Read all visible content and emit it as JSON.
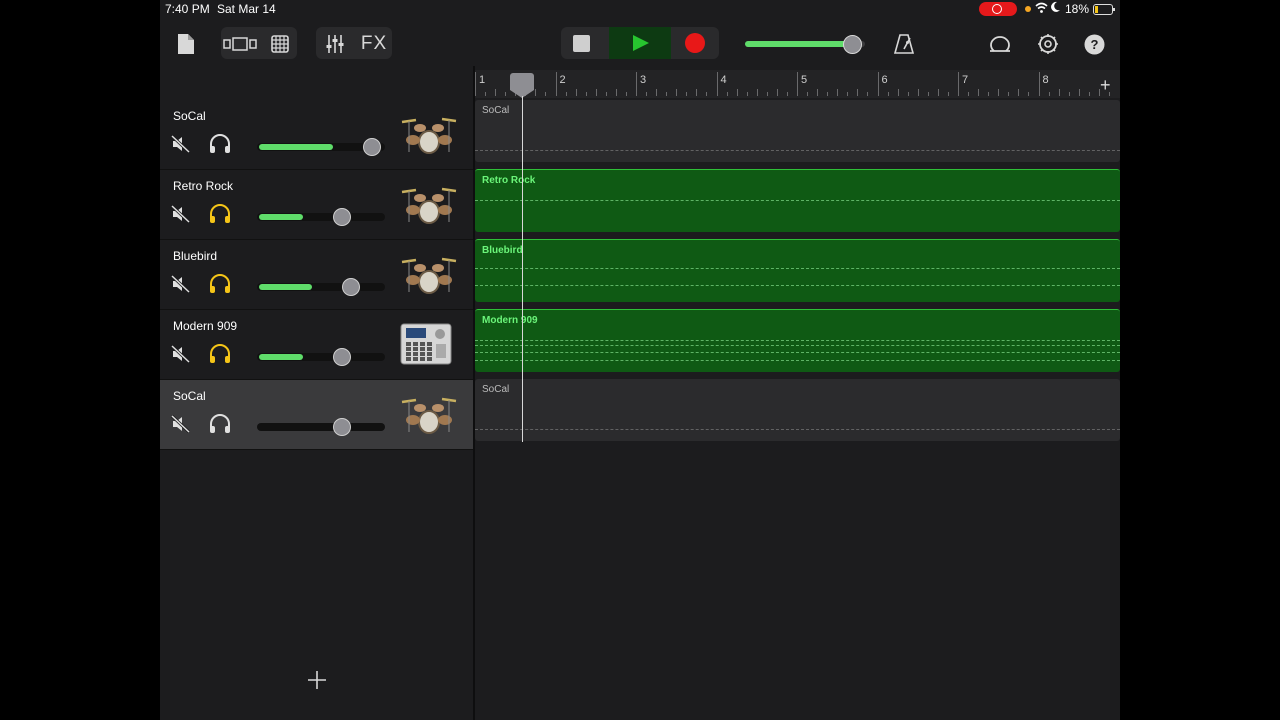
{
  "status_bar": {
    "time": "7:40 PM",
    "date": "Sat Mar 14",
    "battery_percent": "18%",
    "battery_level": 0.18
  },
  "toolbar": {
    "fx_label": "FX",
    "master_volume": 0.88,
    "icons": [
      "document-icon",
      "browser-view-icon",
      "grid-icon",
      "mixer-icon",
      "metronome-icon",
      "loop-icon",
      "settings-icon",
      "help-icon"
    ]
  },
  "accent_colors": {
    "play": "#27c52f",
    "record": "#e81818",
    "region_green": "#0f5a14",
    "volume": "#5fdc6a",
    "solo_active": "#f5c518"
  },
  "ruler": {
    "bars": [
      "1",
      "2",
      "3",
      "4",
      "5",
      "6",
      "7",
      "8"
    ]
  },
  "tracks": [
    {
      "name": "SoCal",
      "volume": 0.92,
      "solo_active": false,
      "selected": false,
      "instrument": "drum-kit-icon",
      "region_color": "grey"
    },
    {
      "name": "Retro Rock",
      "volume": 0.68,
      "solo_active": true,
      "selected": false,
      "instrument": "drum-kit-icon",
      "region_color": "green"
    },
    {
      "name": "Bluebird",
      "volume": 0.75,
      "solo_active": true,
      "selected": false,
      "instrument": "drum-kit-icon",
      "region_color": "green"
    },
    {
      "name": "Modern 909",
      "volume": 0.68,
      "solo_active": true,
      "selected": false,
      "instrument": "drum-machine-icon",
      "region_color": "green"
    },
    {
      "name": "SoCal",
      "volume": 0.68,
      "solo_active": false,
      "selected": true,
      "instrument": "drum-kit-icon",
      "region_color": "grey"
    }
  ]
}
